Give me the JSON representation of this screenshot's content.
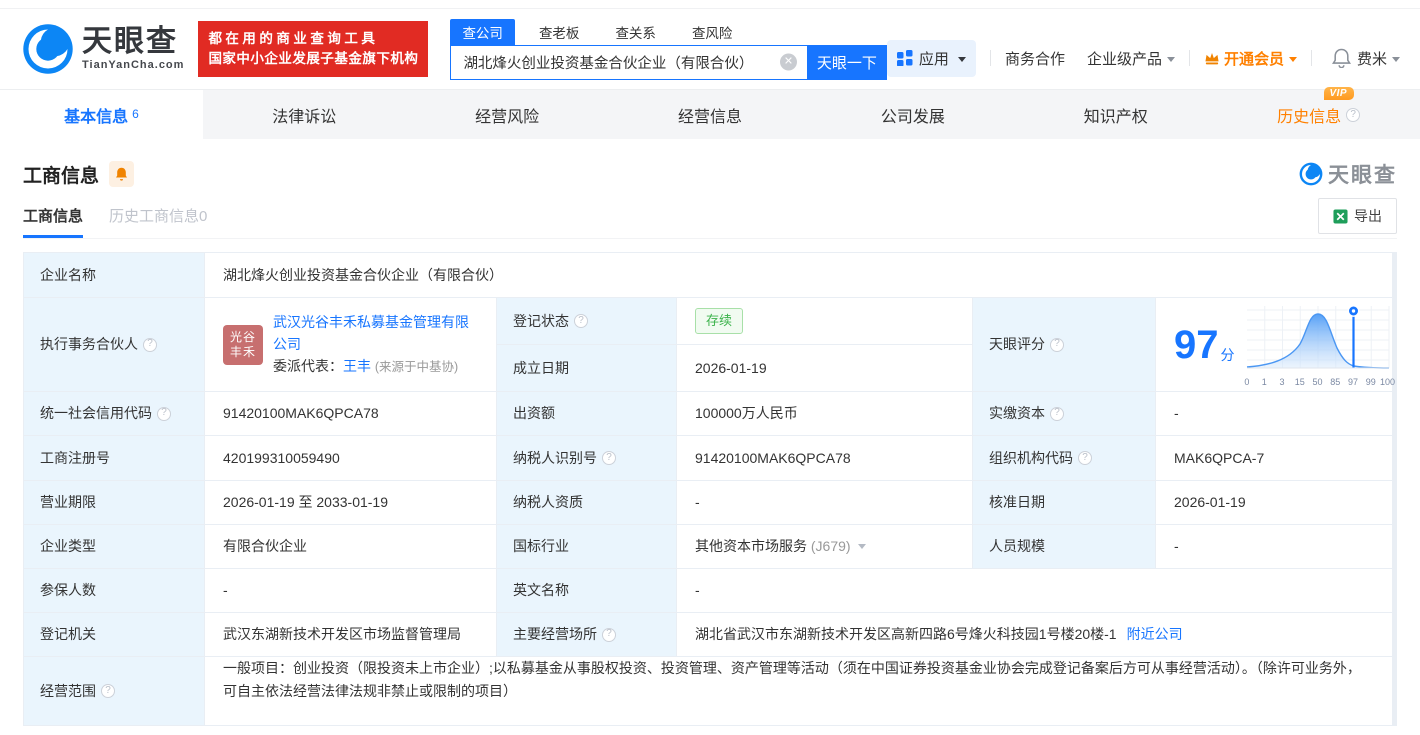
{
  "colors": {
    "primary_blue": "#1775ff",
    "brand_red": "#e12b23",
    "orange": "#ff8000",
    "green": "#3cb34c",
    "label_cell_bg": "#eaf5fd"
  },
  "header": {
    "logo": {
      "brand": "天眼查",
      "domain": "TianYanCha.com"
    },
    "slogan": {
      "line1": "都在用的商业查询工具",
      "line2": "国家中小企业发展子基金旗下机构"
    },
    "search": {
      "tabs": [
        {
          "label": "查公司",
          "active": true
        },
        {
          "label": "查老板",
          "active": false
        },
        {
          "label": "查关系",
          "active": false
        },
        {
          "label": "查风险",
          "active": false
        }
      ],
      "input_value": "湖北烽火创业投资基金合伙企业（有限合伙）",
      "button_label": "天眼一下"
    },
    "nav": {
      "apps": "应用",
      "cooperation": "商务合作",
      "enterprise": "企业级产品",
      "vip": "开通会员",
      "username": "费米"
    }
  },
  "tabs": [
    {
      "label": "基本信息",
      "count": "6",
      "active": true
    },
    {
      "label": "法律诉讼"
    },
    {
      "label": "经营风险"
    },
    {
      "label": "经营信息"
    },
    {
      "label": "公司发展"
    },
    {
      "label": "知识产权"
    },
    {
      "label": "历史信息",
      "vip": "VIP"
    }
  ],
  "section": {
    "title": "工商信息",
    "watermark": "天眼查",
    "subtabs": [
      {
        "label": "工商信息",
        "active": true
      },
      {
        "label": "历史工商信息0",
        "active": false
      }
    ],
    "export_label": "导出"
  },
  "table": {
    "company_name": {
      "label": "企业名称",
      "value": "湖北烽火创业投资基金合伙企业（有限合伙）"
    },
    "partner": {
      "label": "执行事务合伙人",
      "avatar": "光谷丰禾",
      "company": "武汉光谷丰禾私募基金管理有限公司",
      "delegate_label": "委派代表：",
      "delegate": "王丰",
      "delegate_source": "(来源于中基协)"
    },
    "reg_status": {
      "label": "登记状态",
      "value": "存续"
    },
    "establish_date": {
      "label": "成立日期",
      "value": "2026-01-19"
    },
    "score": {
      "label": "天眼评分",
      "value": "97",
      "unit": "分"
    },
    "credit_code": {
      "label": "统一社会信用代码",
      "value": "91420100MAK6QPCA78"
    },
    "capital": {
      "label": "出资额",
      "value": "100000万人民币"
    },
    "paid_capital": {
      "label": "实缴资本",
      "value": "-"
    },
    "reg_number": {
      "label": "工商注册号",
      "value": "420199310059490"
    },
    "taxpayer_id": {
      "label": "纳税人识别号",
      "value": "91420100MAK6QPCA78"
    },
    "org_code": {
      "label": "组织机构代码",
      "value": "MAK6QPCA-7"
    },
    "business_term": {
      "label": "营业期限",
      "value": "2026-01-19 至 2033-01-19"
    },
    "taxpayer_quality": {
      "label": "纳税人资质",
      "value": "-"
    },
    "approve_date": {
      "label": "核准日期",
      "value": "2026-01-19"
    },
    "company_type": {
      "label": "企业类型",
      "value": "有限合伙企业"
    },
    "industry": {
      "label": "国标行业",
      "value": "其他资本市场服务",
      "code": "(J679)"
    },
    "staff_size": {
      "label": "人员规模",
      "value": "-"
    },
    "insured_count": {
      "label": "参保人数",
      "value": "-"
    },
    "english_name": {
      "label": "英文名称",
      "value": "-"
    },
    "reg_authority": {
      "label": "登记机关",
      "value": "武汉东湖新技术开发区市场监督管理局"
    },
    "business_site": {
      "label": "主要经营场所",
      "value": "湖北省武汉市东湖新技术开发区高新四路6号烽火科技园1号楼20楼-1",
      "link": "附近公司"
    },
    "business_scope": {
      "label": "经营范围",
      "value": "一般项目：创业投资（限投资未上市企业）;以私募基金从事股权投资、投资管理、资产管理等活动（须在中国证券投资基金业协会完成登记备案后方可从事经营活动）。（除许可业务外，可自主依法经营法律法规非禁止或限制的项目）"
    }
  },
  "chart_data": {
    "type": "area",
    "title": "天眼评分",
    "score": 97,
    "score_unit": "分",
    "x_ticks": [
      "0",
      "1",
      "3",
      "15",
      "50",
      "85",
      "97",
      "99",
      "100"
    ],
    "marker_value": 97,
    "curve_shape": "bell distribution peaking near 50",
    "grid": true,
    "legend_position": "none"
  }
}
